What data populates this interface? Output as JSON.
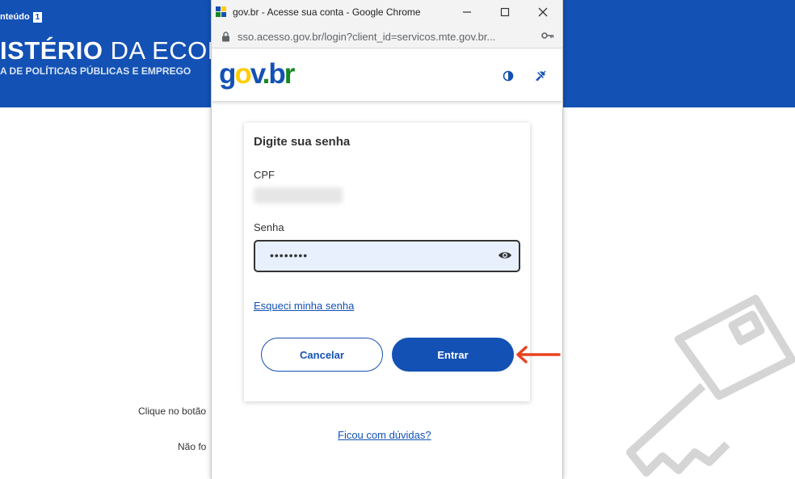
{
  "background_page": {
    "skip_label": "nteúdo",
    "skip_number": "1",
    "ministry_bold": "ISTÉRIO",
    "ministry_rest": " DA ECON",
    "subtitle": "A DE POLÍTICAS PÚBLICAS E EMPREGO",
    "line1": "Clique no botão",
    "line2": "Não fo"
  },
  "window": {
    "title": "gov.br - Acesse sua conta - Google Chrome",
    "url": "sso.acesso.gov.br/login?client_id=servicos.mte.gov.br..."
  },
  "logo": {
    "g": "g",
    "o": "o",
    "v": "v",
    "dot": ".",
    "b": "b",
    "r": "r"
  },
  "form": {
    "heading": "Digite sua senha",
    "cpf_label": "CPF",
    "password_label": "Senha",
    "password_value": "••••••••",
    "forgot_link": "Esqueci minha senha",
    "cancel_label": "Cancelar",
    "enter_label": "Entrar"
  },
  "help_link": "Ficou com dúvidas?",
  "colors": {
    "brand_blue": "#1351b4",
    "input_fill": "#e8f0fe",
    "annotation_arrow": "#e8431f"
  }
}
